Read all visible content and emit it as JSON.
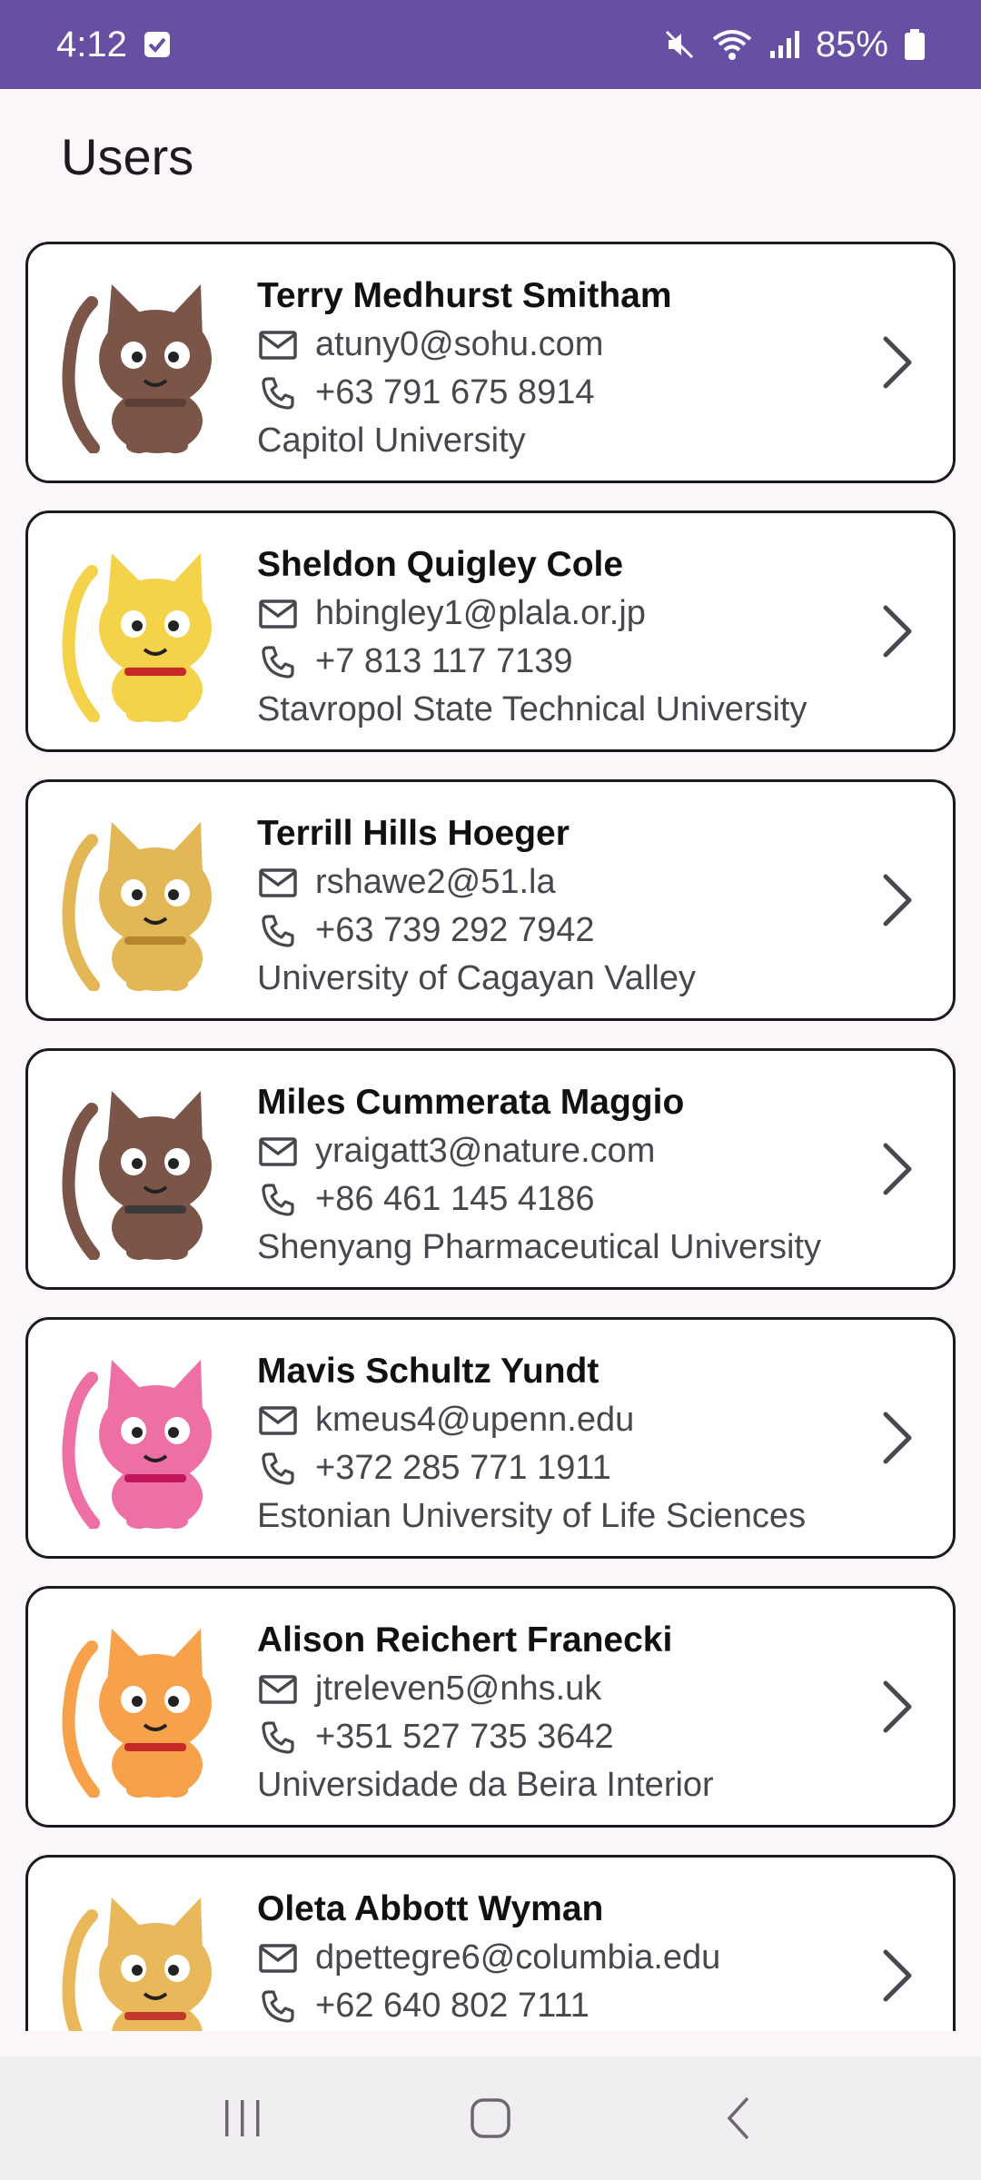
{
  "status_bar": {
    "time": "4:12",
    "battery": "85%"
  },
  "page": {
    "title": "Users"
  },
  "users": [
    {
      "name": "Terry Medhurst Smitham",
      "email": "atuny0@sohu.com",
      "phone": "+63 791 675 8914",
      "university": "Capitol University",
      "avatar_color": "#7a5548",
      "avatar_accent": "#5d3f36"
    },
    {
      "name": "Sheldon Quigley Cole",
      "email": "hbingley1@plala.or.jp",
      "phone": "+7 813 117 7139",
      "university": "Stavropol State Technical University",
      "avatar_color": "#f4d24a",
      "avatar_accent": "#c62828"
    },
    {
      "name": "Terrill Hills Hoeger",
      "email": "rshawe2@51.la",
      "phone": "+63 739 292 7942",
      "university": "University of Cagayan Valley",
      "avatar_color": "#e3b656",
      "avatar_accent": "#b8862f"
    },
    {
      "name": "Miles Cummerata Maggio",
      "email": "yraigatt3@nature.com",
      "phone": "+86 461 145 4186",
      "university": "Shenyang Pharmaceutical University",
      "avatar_color": "#7a5548",
      "avatar_accent": "#3a3a3a"
    },
    {
      "name": "Mavis Schultz Yundt",
      "email": "kmeus4@upenn.edu",
      "phone": "+372 285 771 1911",
      "university": "Estonian University of Life Sciences",
      "avatar_color": "#ee6fa3",
      "avatar_accent": "#c2185b"
    },
    {
      "name": "Alison Reichert Franecki",
      "email": "jtreleven5@nhs.uk",
      "phone": "+351 527 735 3642",
      "university": "Universidade da Beira Interior",
      "avatar_color": "#f7a14a",
      "avatar_accent": "#c62828"
    },
    {
      "name": "Oleta Abbott Wyman",
      "email": "dpettegre6@columbia.edu",
      "phone": "+62 640 802 7111",
      "university": "",
      "avatar_color": "#e8b85a",
      "avatar_accent": "#c0392b"
    }
  ]
}
